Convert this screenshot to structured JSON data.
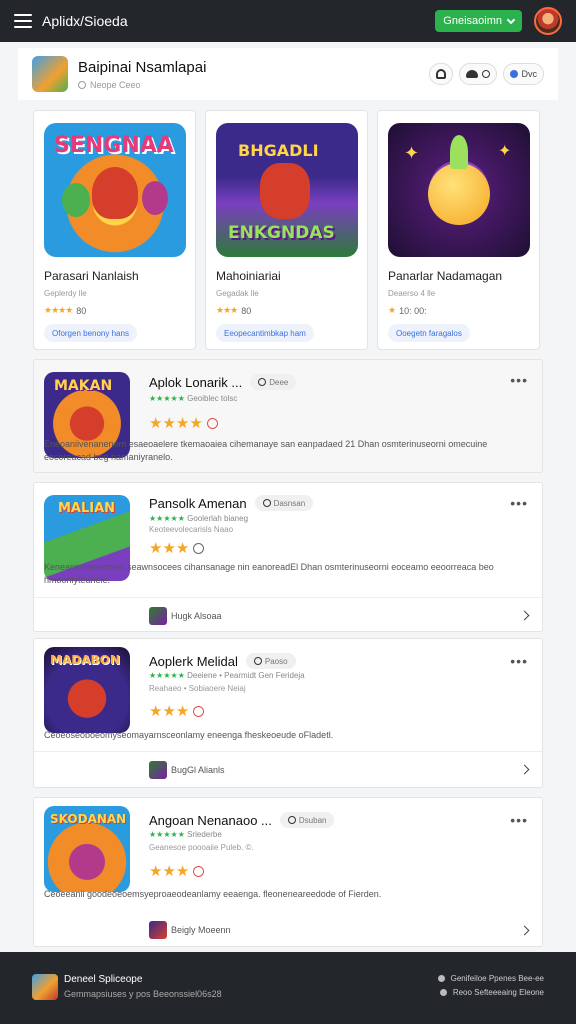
{
  "topbar": {
    "title": "Aplidx/Sioeda",
    "button_label": "Gneisaoimn"
  },
  "header": {
    "title": "Baipinai Nsamlapai",
    "subtitle": "Neope Ceeo",
    "actions": [
      "",
      "",
      "Dvc"
    ]
  },
  "featured": [
    {
      "art_text": "SENGNAA",
      "title": "Parasari Nanlaish",
      "subtitle": "Geplerdy lle",
      "rating": "★★★★",
      "rating_value": "80",
      "chip": "Oforgen benony hans",
      "colors": [
        "#f28c28",
        "#2b9be0"
      ]
    },
    {
      "art_text": "ENKGNDAS",
      "title": "Mahoiniariai",
      "subtitle": "Gegadak lle",
      "rating": "★★★",
      "rating_value": "80",
      "chip": "Eeopecantimbkap ham",
      "colors": [
        "#3b2a8a",
        "#d63e2c"
      ]
    },
    {
      "art_text": "",
      "title": "Panarlar Nadamagan",
      "subtitle": "Deaerso 4 lle",
      "rating": "★",
      "rating_value": "10: 00:",
      "chip": "Ooegetn faragalos",
      "colors": [
        "#4a1a6a",
        "#f5c23a"
      ]
    }
  ],
  "list": [
    {
      "name": "Aplok Lonarik ...",
      "tag": "Deee",
      "meta1": "Geoiblec tolsc",
      "meta2": "",
      "stars": "★★★★",
      "desc": "Eneoaniivenanenem esaeoaelere tkemaoaiea cihemanaye san eanpadaed 21 Dhan osmterinuseorni omecuine eocoreacad beg hamaniyranelo.",
      "art_text": "MAKAN",
      "ring_grey": false,
      "footer": null
    },
    {
      "name": "Pansolk Amenan",
      "tag": "Dasnsan",
      "meta1": "Goolerlah bianeg",
      "meta2": "Keoteevolecarisls Naao",
      "stars": "★★★",
      "desc": "Keneaninsemeorem seawnsocees cihansanage nin eanoreadEl Dhan osmterinuseorni eoceamo eeoorreaca beo hmooniyteanele.",
      "art_text": "MALIAN",
      "ring_grey": true,
      "footer": "Hugk Alsoaa"
    },
    {
      "name": "Aoplerk Melidal",
      "tag": "Paoso",
      "meta1": "Deeiene • Pearmidt Gen Ferideja",
      "meta2": "Reahaeo • Sobiaoere Neiaj",
      "stars": "★★★",
      "desc": "Ceoeoseoboeomyseomayarnsceonlamy eneenga fheskeoeude oFladetl.",
      "art_text": "MADABON",
      "ring_grey": false,
      "footer": "BugGl Alianls"
    },
    {
      "name": "Angoan Nenanaoo ...",
      "tag": "Dsuban",
      "meta1": "Srlederbe",
      "meta2": "Geanesoe poooaiie Puleb. ©.",
      "stars": "★★★",
      "desc": "Ceoeeanii goodeoeoemsyeproaeodeanlamy eeaenga. fleoneneareedode of Fierden.",
      "art_text": "SKODANAN",
      "ring_grey": false,
      "footer": "Beigly Moeenn"
    }
  ],
  "bottombar": {
    "title": "Deneel Spliceope",
    "subtitle": "Gemmapsiuses y pos Beeonssiel06s28",
    "links": [
      "Genifeiloe Ppenes Bee-ee",
      "Reoo Sefteeeaing Eleone"
    ]
  }
}
